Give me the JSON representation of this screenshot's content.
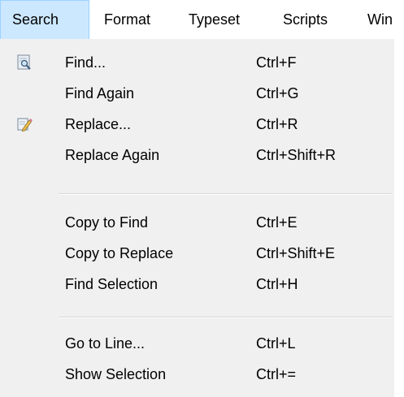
{
  "menubar": {
    "items": [
      {
        "label": "Search"
      },
      {
        "label": "Format"
      },
      {
        "label": "Typeset"
      },
      {
        "label": "Scripts"
      },
      {
        "label": "Win"
      }
    ]
  },
  "menu": {
    "items": [
      {
        "label": "Find...",
        "shortcut": "Ctrl+F",
        "icon": "find-icon"
      },
      {
        "label": "Find Again",
        "shortcut": "Ctrl+G"
      },
      {
        "label": "Replace...",
        "shortcut": "Ctrl+R",
        "icon": "replace-icon"
      },
      {
        "label": "Replace Again",
        "shortcut": "Ctrl+Shift+R"
      },
      {
        "label": "Copy to Find",
        "shortcut": "Ctrl+E"
      },
      {
        "label": "Copy to Replace",
        "shortcut": "Ctrl+Shift+E"
      },
      {
        "label": "Find Selection",
        "shortcut": "Ctrl+H"
      },
      {
        "label": "Go to Line...",
        "shortcut": "Ctrl+L"
      },
      {
        "label": "Show Selection",
        "shortcut": "Ctrl+="
      }
    ]
  },
  "colors": {
    "active_menu_bg": "#cce8ff",
    "active_menu_border": "#99d1ff",
    "dropdown_bg": "#f0f0f0"
  }
}
